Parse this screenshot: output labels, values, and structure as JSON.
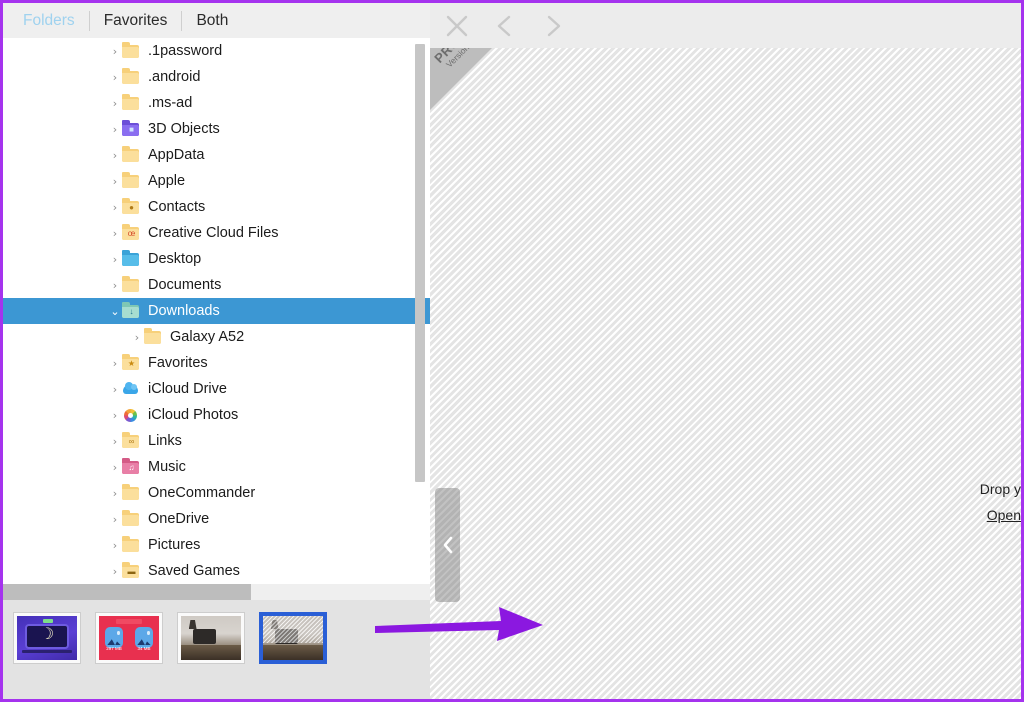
{
  "window": {
    "accent_border_color": "#a533ee",
    "panel_bg": "#efefef"
  },
  "tabs": {
    "items": [
      {
        "label": "Folders",
        "active": true
      },
      {
        "label": "Favorites",
        "active": false
      },
      {
        "label": "Both",
        "active": false
      }
    ],
    "active_color": "#9fd2ef"
  },
  "tree": {
    "selection_color": "#3c97d3",
    "items": [
      {
        "label": ".1password",
        "icon": "folder-yellow",
        "indent": 0,
        "expander": "collapsed",
        "selected": false
      },
      {
        "label": ".android",
        "icon": "folder-yellow",
        "indent": 0,
        "expander": "collapsed",
        "selected": false
      },
      {
        "label": ".ms-ad",
        "icon": "folder-yellow",
        "indent": 0,
        "expander": "collapsed",
        "selected": false
      },
      {
        "label": "3D Objects",
        "icon": "folder-3d",
        "indent": 0,
        "expander": "collapsed",
        "selected": false
      },
      {
        "label": "AppData",
        "icon": "folder-yellow",
        "indent": 0,
        "expander": "collapsed",
        "selected": false
      },
      {
        "label": "Apple",
        "icon": "folder-yellow",
        "indent": 0,
        "expander": "collapsed",
        "selected": false
      },
      {
        "label": "Contacts",
        "icon": "folder-contacts",
        "indent": 0,
        "expander": "collapsed",
        "selected": false
      },
      {
        "label": "Creative Cloud Files",
        "icon": "folder-creative",
        "indent": 0,
        "expander": "collapsed",
        "selected": false
      },
      {
        "label": "Desktop",
        "icon": "folder-desktop",
        "indent": 0,
        "expander": "collapsed",
        "selected": false
      },
      {
        "label": "Documents",
        "icon": "folder-yellow",
        "indent": 0,
        "expander": "collapsed",
        "selected": false
      },
      {
        "label": "Downloads",
        "icon": "folder-downloads",
        "indent": 0,
        "expander": "expanded",
        "selected": true
      },
      {
        "label": "Galaxy A52",
        "icon": "folder-yellow",
        "indent": 1,
        "expander": "collapsed",
        "selected": false
      },
      {
        "label": "Favorites",
        "icon": "folder-favorites",
        "indent": 0,
        "expander": "collapsed",
        "selected": false
      },
      {
        "label": "iCloud Drive",
        "icon": "icloud-drive",
        "indent": 0,
        "expander": "collapsed",
        "selected": false
      },
      {
        "label": "iCloud Photos",
        "icon": "icloud-photos",
        "indent": 0,
        "expander": "collapsed",
        "selected": false
      },
      {
        "label": "Links",
        "icon": "folder-links",
        "indent": 0,
        "expander": "collapsed",
        "selected": false
      },
      {
        "label": "Music",
        "icon": "folder-music",
        "indent": 0,
        "expander": "collapsed",
        "selected": false
      },
      {
        "label": "OneCommander",
        "icon": "folder-yellow",
        "indent": 0,
        "expander": "collapsed",
        "selected": false
      },
      {
        "label": "OneDrive",
        "icon": "folder-yellow",
        "indent": 0,
        "expander": "collapsed",
        "selected": false
      },
      {
        "label": "Pictures",
        "icon": "folder-yellow",
        "indent": 0,
        "expander": "collapsed",
        "selected": false
      },
      {
        "label": "Saved Games",
        "icon": "folder-savedgames",
        "indent": 0,
        "expander": "collapsed",
        "selected": false
      }
    ]
  },
  "filmstrip": {
    "items": [
      {
        "name": "thumbnail-laptop-moon",
        "style": "laptop",
        "selected": false
      },
      {
        "name": "thumbnail-image-compression",
        "style": "compress",
        "selected": false,
        "size_before": "297 MB",
        "size_after": "34 MB"
      },
      {
        "name": "thumbnail-room-photo",
        "style": "room",
        "selected": false
      },
      {
        "name": "thumbnail-room-photo-loading",
        "style": "room",
        "selected": true
      }
    ],
    "selected_border_color": "#2a5fd6"
  },
  "toolbar": {
    "buttons": [
      {
        "name": "close-icon",
        "glyph": "close"
      },
      {
        "name": "previous-icon",
        "glyph": "chevron-left"
      },
      {
        "name": "next-icon",
        "glyph": "chevron-right"
      }
    ]
  },
  "preview": {
    "ribbon_line1": "PRO",
    "ribbon_line2": "Version",
    "drop_hint": "Drop y",
    "open_link": "Open"
  },
  "splitter": {
    "icon": "chevron-left-icon"
  },
  "annotation": {
    "arrow_color": "#8b18e0"
  }
}
